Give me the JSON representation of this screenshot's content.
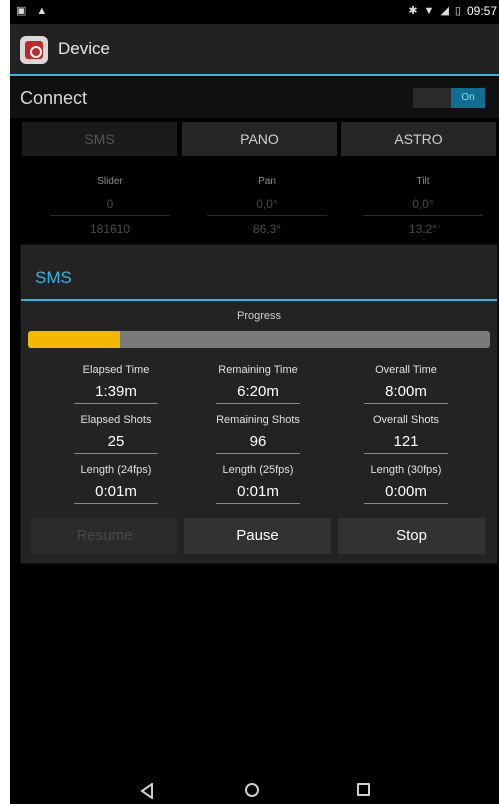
{
  "status_bar": {
    "time": "09:57",
    "icons": [
      "screenshot-icon",
      "android-icon",
      "bluetooth-icon",
      "wifi-icon",
      "signal-icon",
      "battery-icon"
    ]
  },
  "action_bar": {
    "title": "Device",
    "accent_color": "#33b5e5"
  },
  "connect": {
    "label": "Connect",
    "toggle_state": "On"
  },
  "modes": [
    {
      "label": "SMS"
    },
    {
      "label": "PANO"
    },
    {
      "label": "ASTRO"
    }
  ],
  "axes": [
    {
      "name": "Slider",
      "value": "0",
      "value2": "181610"
    },
    {
      "name": "Pan",
      "value": "0,0°",
      "value2": "86,3°"
    },
    {
      "name": "Tilt",
      "value": "0,0°",
      "value2": "13,2°"
    }
  ],
  "dialog": {
    "title": "SMS",
    "progress_label": "Progress",
    "progress_fraction": 0.2,
    "progress_color": "#f5b800",
    "stats": [
      {
        "label": "Elapsed Time",
        "value": "1:39m"
      },
      {
        "label": "Remaining Time",
        "value": "6:20m"
      },
      {
        "label": "Overall Time",
        "value": "8:00m"
      },
      {
        "label": "Elapsed Shots",
        "value": "25"
      },
      {
        "label": "Remaining Shots",
        "value": "96"
      },
      {
        "label": "Overall Shots",
        "value": "121"
      },
      {
        "label": "Length (24fps)",
        "value": "0:01m"
      },
      {
        "label": "Length (25fps)",
        "value": "0:01m"
      },
      {
        "label": "Length (30fps)",
        "value": "0:00m"
      }
    ],
    "buttons": {
      "resume": "Resume",
      "pause": "Pause",
      "stop": "Stop"
    }
  },
  "nav_bar": {
    "icons": [
      "back-icon",
      "home-icon",
      "recents-icon"
    ]
  }
}
